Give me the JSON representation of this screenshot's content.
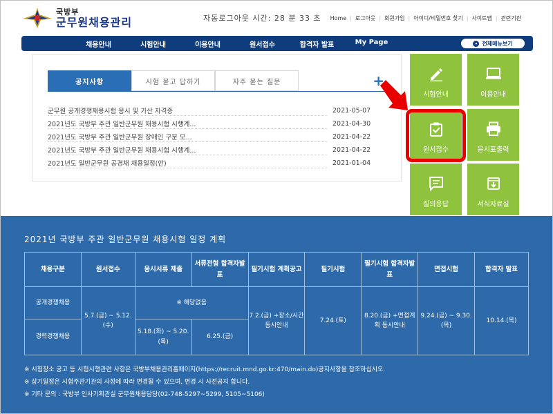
{
  "header": {
    "logo_top": "국방부",
    "logo_main": "군무원채용관리",
    "timer_text": "자동로그아웃 시간: 28 분 33 초",
    "util_links": [
      "Home",
      "로그아웃",
      "회원가입",
      "아이디/비밀번호 찾기",
      "사이트맵",
      "관련기관"
    ]
  },
  "gnb": {
    "items": [
      "채용안내",
      "시험안내",
      "이용안내",
      "원서접수",
      "합격자 발표",
      "My Page"
    ],
    "all_menu": "전체메뉴보기"
  },
  "notice": {
    "tabs": [
      "공지사항",
      "시험 묻고 답하기",
      "자주 묻는 질문"
    ],
    "more": "+",
    "items": [
      {
        "title": "군무원 공개경쟁채용시험 응시 및 가산 자격증",
        "date": "2021-05-07"
      },
      {
        "title": "2021년도 국방부 주관 일반군무원 채용시험 시행계...",
        "date": "2021-04-30"
      },
      {
        "title": "2021년도 국방부 주관 일반군무원 장애인 구분 모...",
        "date": "2021-04-22"
      },
      {
        "title": "2021년도 국방부 주관 일반군무원 채용시험 시행계...",
        "date": "2021-04-22"
      },
      {
        "title": "2021년도 일반군무원 공경채 채용일정(안)",
        "date": "2021-01-04"
      }
    ]
  },
  "quick": {
    "color": "#8fc33e",
    "tiles": [
      {
        "label": "시험안내",
        "icon": "pencil-icon"
      },
      {
        "label": "이용안내",
        "icon": "monitor-icon"
      },
      {
        "label": "원서접수",
        "icon": "clipboard-check-icon"
      },
      {
        "label": "응시표출력",
        "icon": "printer-icon"
      },
      {
        "label": "질의응답",
        "icon": "chat-icon"
      },
      {
        "label": "서식자료실",
        "icon": "download-box-icon"
      }
    ],
    "highlight_color": "#e80000"
  },
  "schedule": {
    "title": "2021년 국방부 주관 일반군무원 채용시험 일정 계획",
    "headers": [
      "채용구분",
      "원서접수",
      "응시서류 제출",
      "서류전형 합격자발표",
      "필기시험 계획공고",
      "필기시험",
      "필기시험 합격자발표",
      "면접시험",
      "합격자 발표"
    ],
    "row1_label": "공개경쟁채용",
    "row2_label": "경력경쟁채용",
    "apply": "5.7.(금) ~ 5.12.(수)",
    "not_applicable": "※ 해당없음",
    "docs_submit": "5.18.(화) ~ 5.20.(목)",
    "docs_pass": "6.25.(금)",
    "written_notice": "7.2.(금) +장소/시간 동시안내",
    "written_exam": "7.24.(토)",
    "written_pass": "8.20.(금) +면접계획 동시안내",
    "interview": "9.24.(금) ~ 9.30.(목)",
    "final": "10.14.(목)",
    "notes": [
      "※ 시험장소 공고 등 시험시행관련 사항은 국방부채용관리홈페이지(https://recruit.mnd.go.kr:470/main.do)공지사항을 참조하십시오.",
      "※ 상기일정은 시험주관기관의 사정에 따라 변경될 수 있으며, 변경 시 사전공지 합니다.",
      "※ 기타 문의 : 국방부 인사기획관실 군무원채용담당(02-748-5297~5299, 5105~5106)"
    ]
  }
}
